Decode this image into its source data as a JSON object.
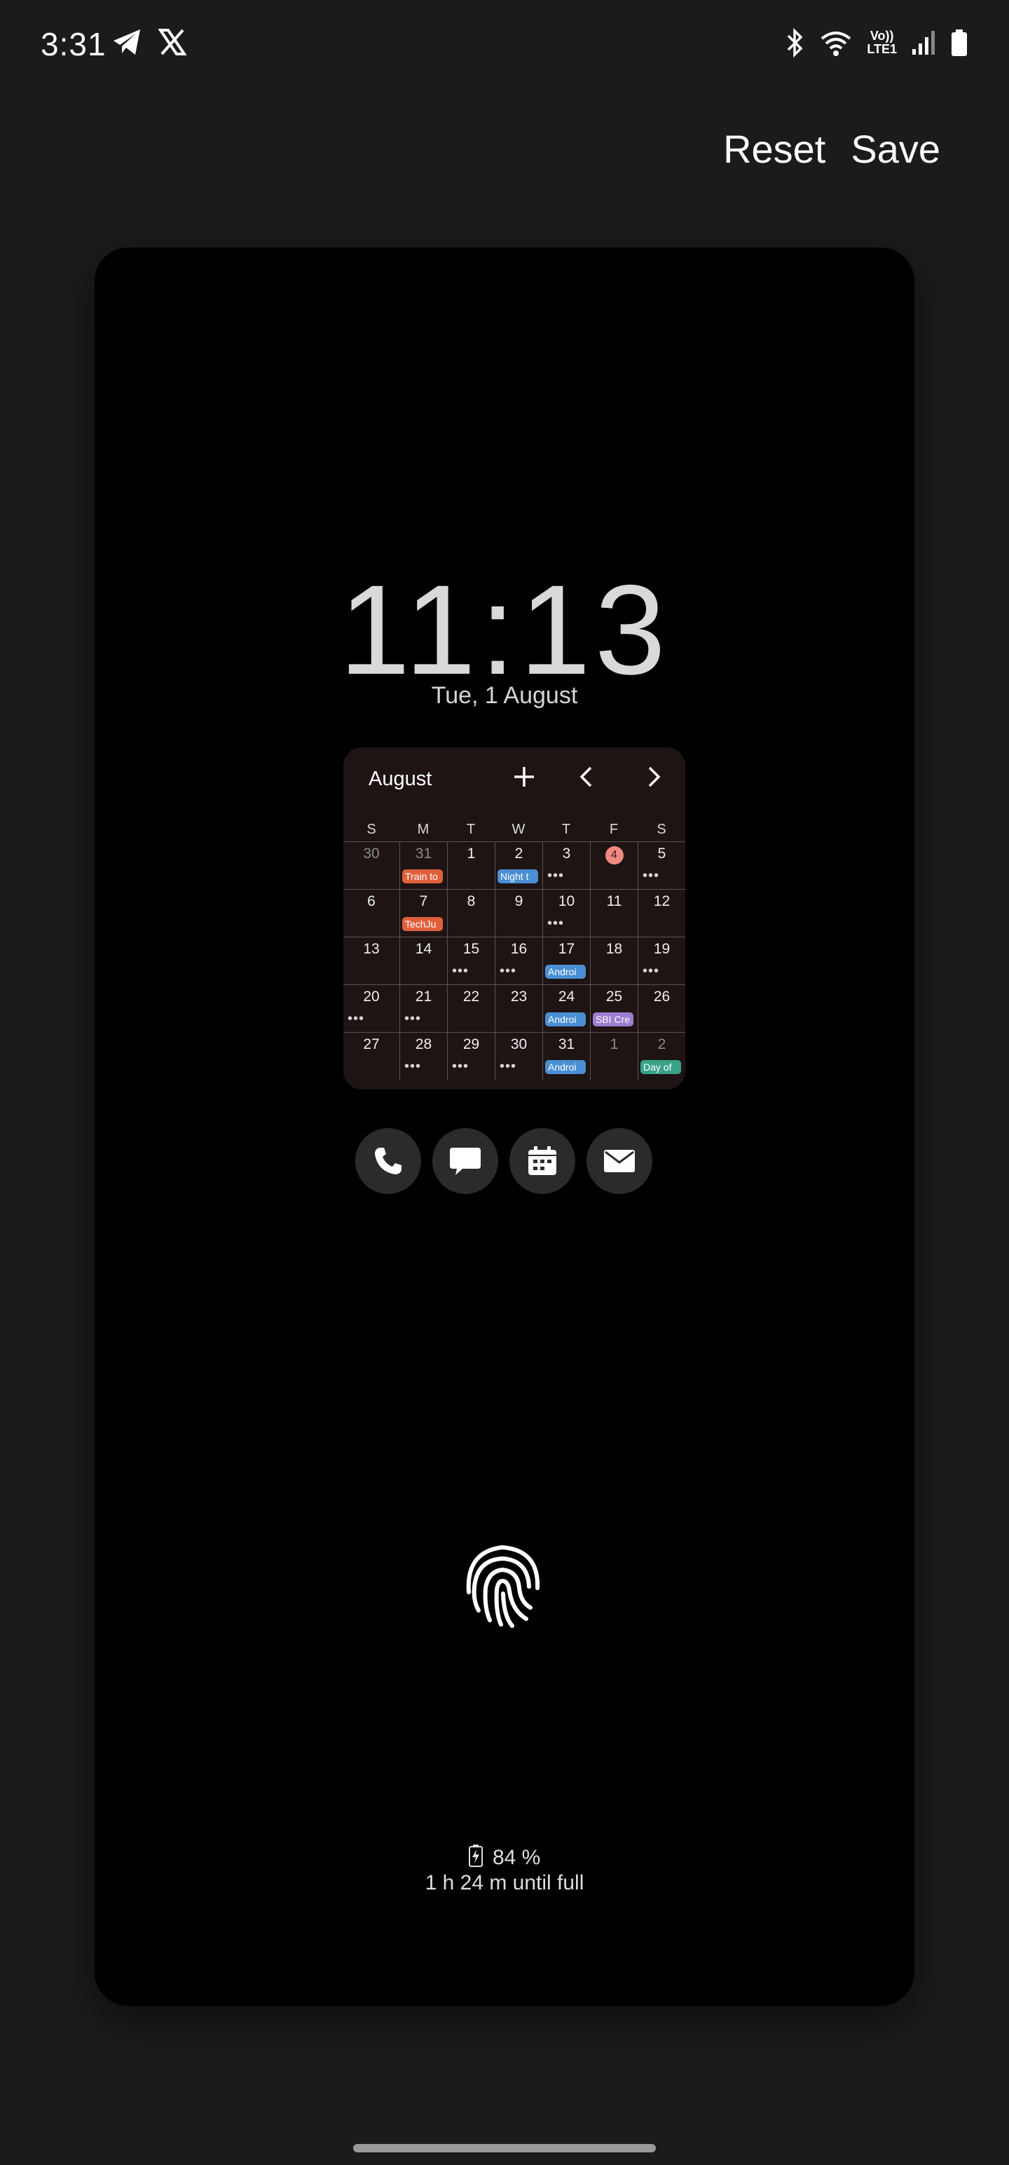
{
  "status": {
    "time": "3:31",
    "left_icons": [
      "telegram-icon",
      "x-icon"
    ],
    "right_icons": [
      "bluetooth-icon",
      "wifi-icon",
      "volte-icon",
      "signal-icon",
      "battery-icon"
    ],
    "volte_top": "Vo))",
    "volte_bottom": "LTE1"
  },
  "actions": {
    "reset_label": "Reset",
    "save_label": "Save"
  },
  "lockscreen": {
    "time": "11:13",
    "date": "Tue, 1 August",
    "battery_percent": "84 %",
    "battery_sub": "1 h 24 m until full"
  },
  "calendar": {
    "month": "August",
    "weekdays": [
      "S",
      "M",
      "T",
      "W",
      "T",
      "F",
      "S"
    ],
    "weeks": [
      [
        {
          "n": "30",
          "dim": true
        },
        {
          "n": "31",
          "dim": true,
          "ev": "Train to",
          "color": "#e0603c"
        },
        {
          "n": "1"
        },
        {
          "n": "2",
          "ev": "Night t",
          "color": "#4a8fd4"
        },
        {
          "n": "3",
          "dots": true
        },
        {
          "n": "4",
          "today": true
        },
        {
          "n": "5",
          "dots": true
        }
      ],
      [
        {
          "n": "6"
        },
        {
          "n": "7",
          "ev": "TechJu",
          "color": "#e0603c"
        },
        {
          "n": "8"
        },
        {
          "n": "9"
        },
        {
          "n": "10",
          "dots": true
        },
        {
          "n": "11"
        },
        {
          "n": "12"
        }
      ],
      [
        {
          "n": "13"
        },
        {
          "n": "14"
        },
        {
          "n": "15",
          "dots": true
        },
        {
          "n": "16",
          "dots": true
        },
        {
          "n": "17",
          "ev": "Androi",
          "color": "#4a8fd4"
        },
        {
          "n": "18"
        },
        {
          "n": "19",
          "dots": true
        }
      ],
      [
        {
          "n": "20",
          "dots": true
        },
        {
          "n": "21",
          "dots": true
        },
        {
          "n": "22"
        },
        {
          "n": "23"
        },
        {
          "n": "24",
          "ev": "Androi",
          "color": "#4a8fd4"
        },
        {
          "n": "25",
          "ev": "SBI Cre",
          "color": "#9d7ed0"
        },
        {
          "n": "26"
        }
      ],
      [
        {
          "n": "27"
        },
        {
          "n": "28",
          "dots": true
        },
        {
          "n": "29",
          "dots": true
        },
        {
          "n": "30",
          "dots": true
        },
        {
          "n": "31",
          "ev": "Androi",
          "color": "#4a8fd4"
        },
        {
          "n": "1",
          "dim": true
        },
        {
          "n": "2",
          "dim": true,
          "ev": "Day of",
          "color": "#3aa287"
        }
      ]
    ]
  },
  "shortcuts": [
    "phone-icon",
    "messages-icon",
    "calendar-icon",
    "email-icon"
  ],
  "colors": {
    "today_badge": "#f08a80",
    "widget_bg": "#1e1414",
    "screen_bg": "#1b1b1b"
  }
}
